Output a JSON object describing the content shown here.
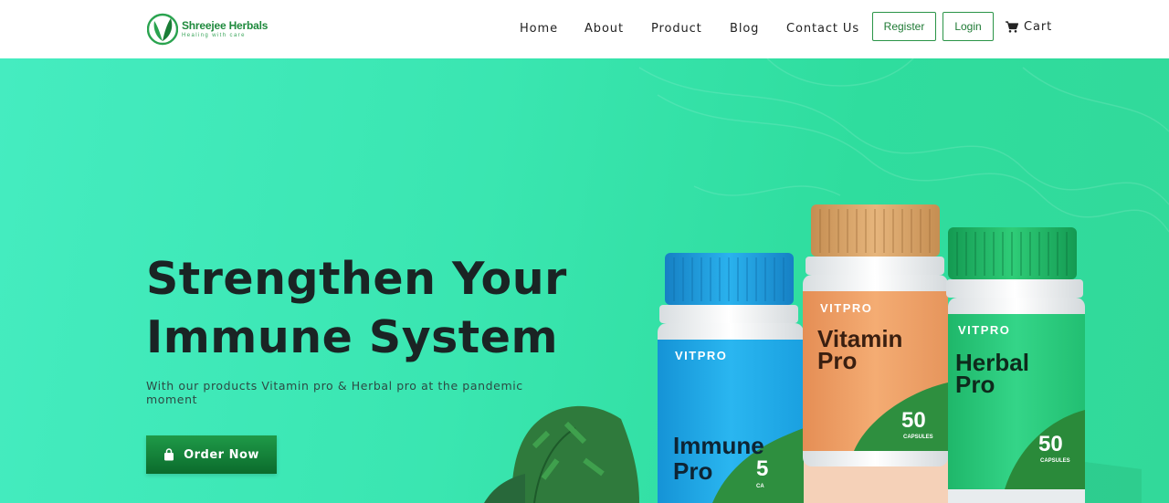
{
  "brand": {
    "name": "Shreejee Herbals",
    "tagline": "Healing with care",
    "colors": {
      "primary": "#1f8a3d",
      "hero_bg": "#3ae6b1",
      "text_dark": "#1a2424"
    }
  },
  "nav": {
    "links": [
      "Home",
      "About",
      "Product",
      "Blog",
      "Contact Us"
    ],
    "register_label": "Register",
    "login_label": "Login",
    "cart_label": "Cart",
    "cart_icon": "shopping-cart-icon"
  },
  "hero": {
    "title_line1": "Strengthen Your",
    "title_line2": "Immune System",
    "subtitle": "With our products Vitamin pro & Herbal pro at the pandemic moment",
    "cta_label": "Order Now",
    "cta_icon": "shopping-bag-icon"
  },
  "products": [
    {
      "brand": "VITPRO",
      "name_line1": "Immune",
      "name_line2": "Pro",
      "count": "5",
      "unit": "CA",
      "cap_color": "#1ea3df",
      "label_color": "#26b3ee"
    },
    {
      "brand": "VITPRO",
      "name_line1": "Vitamin",
      "name_line2": "Pro",
      "count": "50",
      "unit": "CAPSULES",
      "cap_color": "#d9a86a",
      "label_color": "#f0a36a"
    },
    {
      "brand": "VITPRO",
      "name_line1": "Herbal",
      "name_line2": "Pro",
      "count": "50",
      "unit": "CAPSULES",
      "cap_color": "#1fba6a",
      "label_color": "#2fcf7e"
    }
  ]
}
